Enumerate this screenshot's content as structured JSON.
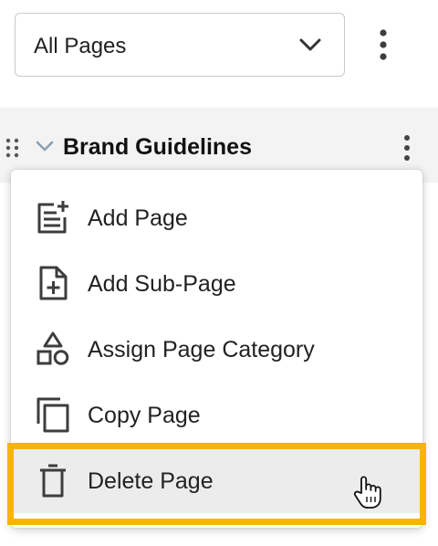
{
  "page_filter": {
    "value": "All Pages",
    "icon": "chevron-down-icon"
  },
  "toolbar": {
    "more_icon": "more-vertical-icon"
  },
  "tree": {
    "item": {
      "title": "Brand Guidelines",
      "expanded": true,
      "drag_icon": "drag-handle-icon",
      "more_icon": "more-vertical-icon"
    }
  },
  "context_menu": {
    "items": [
      {
        "label": "Add Page",
        "icon": "add-page-icon"
      },
      {
        "label": "Add Sub-Page",
        "icon": "add-sub-page-icon"
      },
      {
        "label": "Assign Page Category",
        "icon": "category-shapes-icon"
      },
      {
        "label": "Copy Page",
        "icon": "copy-icon"
      },
      {
        "label": "Delete Page",
        "icon": "trash-icon",
        "highlighted": true
      }
    ]
  },
  "colors": {
    "highlight_border": "#f7b500",
    "row_background": "#f3f3f3",
    "hover_background": "#ececec",
    "icon_color": "#3d3d3d"
  }
}
